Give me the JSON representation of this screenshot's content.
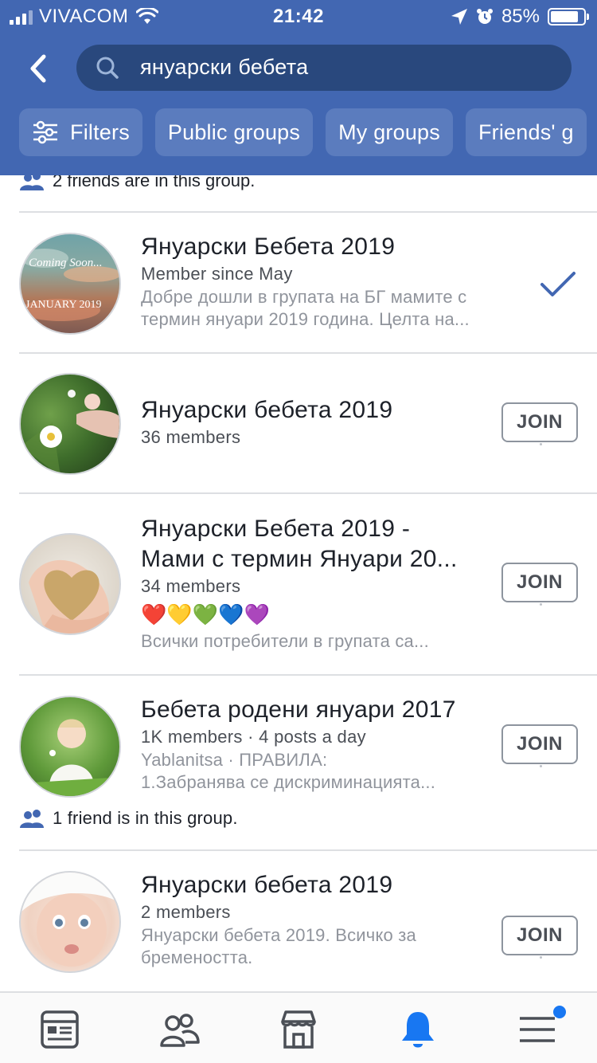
{
  "status_bar": {
    "carrier": "VIVACOM",
    "time": "21:42",
    "battery": "85%",
    "battery_level": 0.85
  },
  "search": {
    "query": "януарски бебета"
  },
  "filters": [
    {
      "label": "Filters",
      "icon": "sliders-icon"
    },
    {
      "label": "Public groups"
    },
    {
      "label": "My groups"
    },
    {
      "label": "Friends' g"
    }
  ],
  "partial_row": {
    "friends_text": "2 friends are in this group."
  },
  "groups": [
    {
      "title": "Януарски Бебета 2019",
      "meta": "Member since May",
      "desc_line1": "Добре дошли в групата на БГ мамите с",
      "desc_line2": "термин януари 2019 година. Целта на...",
      "action": "check",
      "avatar_text_top": "Coming Soon...",
      "avatar_text_bottom": "JANUARY 2019"
    },
    {
      "title": "Януарски бебета 2019",
      "meta": "36 members",
      "action": "JOIN"
    },
    {
      "title_line1": "Януарски Бебета 2019 -",
      "title_line2": "Мами с термин Януари 20...",
      "meta": "34 members",
      "hearts": "❤️💛💚💙💜",
      "desc": "Всички потребители в групата са...",
      "action": "JOIN"
    },
    {
      "title": "Бебета родени януари 2017",
      "meta": "1K members · 4 posts a day",
      "desc_line1": "Yablanitsa · ПРАВИЛА:",
      "desc_line2": "1.Забранява се дискриминацията...",
      "friends_text": "1 friend is in this group.",
      "action": "JOIN"
    },
    {
      "title": "Януарски бебета 2019",
      "meta": "2 members",
      "desc_line1": "Януарски бебета 2019. Всичко за",
      "desc_line2": "бремеността.",
      "action": "JOIN"
    }
  ],
  "tabbar": [
    {
      "name": "news-feed-icon",
      "active": false
    },
    {
      "name": "friends-icon",
      "active": false
    },
    {
      "name": "marketplace-icon",
      "active": false
    },
    {
      "name": "notifications-bell-icon",
      "active": true
    },
    {
      "name": "menu-icon",
      "active": false,
      "badge": true
    }
  ],
  "colors": {
    "header": "#4267b2",
    "search_box": "#29487d",
    "chip": "#5b7cbe",
    "accent": "#1877f2",
    "check": "#4267b2"
  }
}
